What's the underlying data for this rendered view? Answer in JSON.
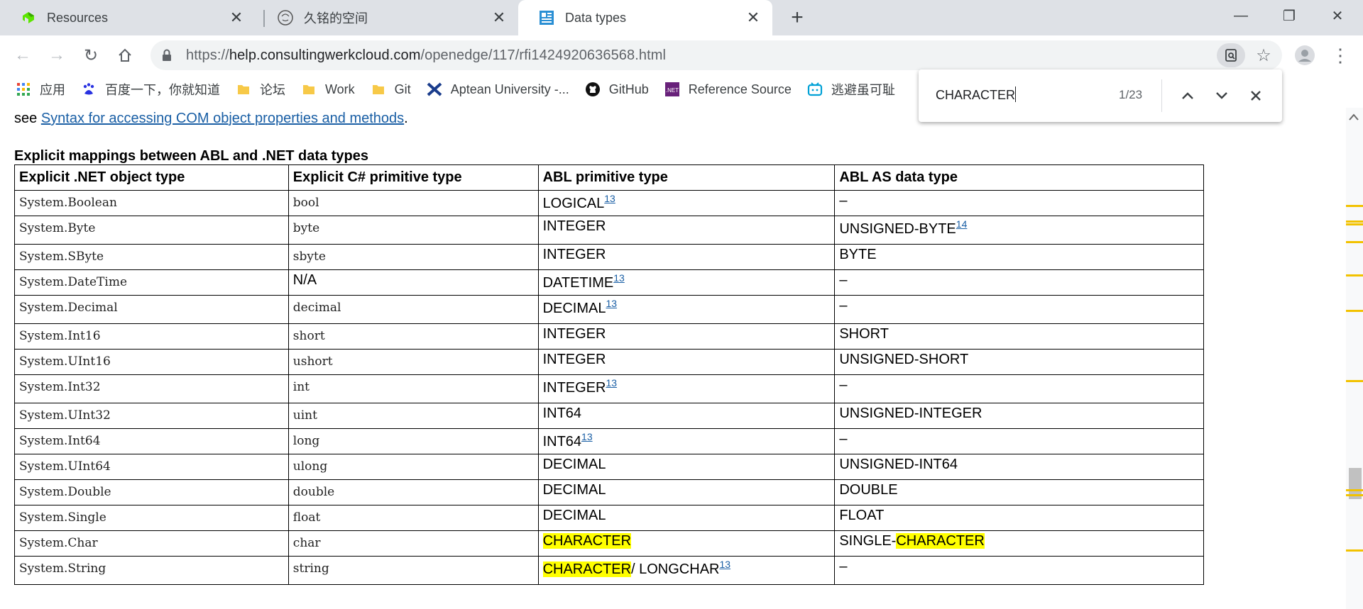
{
  "tabs": [
    {
      "title": "Resources",
      "icon": "progress-logo-icon",
      "active": false
    },
    {
      "title": "久铭的空间",
      "icon": "avatar-sketch-icon",
      "active": false
    },
    {
      "title": "Data types",
      "icon": "document-grid-icon",
      "active": true
    }
  ],
  "omnibox": {
    "url_scheme": "https://",
    "url_host": "help.consultingwerkcloud.com",
    "url_path": "/openedge/117/rfi1424920636568.html"
  },
  "bookmarks": [
    {
      "label": "应用",
      "icon": "apps-grid-icon"
    },
    {
      "label": "百度一下，你就知道",
      "icon": "baidu-paw-icon"
    },
    {
      "label": "论坛",
      "icon": "folder-icon"
    },
    {
      "label": "Work",
      "icon": "folder-icon"
    },
    {
      "label": "Git",
      "icon": "folder-icon"
    },
    {
      "label": "Aptean University -...",
      "icon": "aptean-x-icon"
    },
    {
      "label": "GitHub",
      "icon": "github-icon"
    },
    {
      "label": "Reference Source",
      "icon": "dotnet-icon"
    },
    {
      "label": "逃避虽可耻",
      "icon": "bilibili-icon"
    }
  ],
  "page": {
    "intro_prefix": "see ",
    "intro_link": "Syntax for accessing COM object properties and methods",
    "intro_suffix": ".",
    "table_caption": "Explicit mappings between ABL and .NET data types",
    "headers": [
      "Explicit .NET object type",
      "Explicit C# primitive type",
      "ABL primitive type",
      "ABL AS data type"
    ],
    "rows": [
      {
        "net": "System.Boolean",
        "cs": "bool",
        "abl": "LOGICAL",
        "abl_note": "13",
        "as": "–"
      },
      {
        "net": "System.Byte",
        "cs": "byte",
        "abl": "INTEGER",
        "abl_note": "",
        "as": "UNSIGNED-BYTE",
        "as_note": "14"
      },
      {
        "net": "System.SByte",
        "cs": "sbyte",
        "abl": "INTEGER",
        "abl_note": "",
        "as": "BYTE"
      },
      {
        "net": "System.DateTime",
        "cs": "N/A",
        "abl": "DATETIME",
        "abl_note": "13",
        "as": "–"
      },
      {
        "net": "System.Decimal",
        "cs": "decimal",
        "abl": "DECIMAL",
        "abl_note": "13",
        "as": "–"
      },
      {
        "net": "System.Int16",
        "cs": "short",
        "abl": "INTEGER",
        "abl_note": "",
        "as": "SHORT"
      },
      {
        "net": "System.UInt16",
        "cs": "ushort",
        "abl": "INTEGER",
        "abl_note": "",
        "as": "UNSIGNED-SHORT"
      },
      {
        "net": "System.Int32",
        "cs": "int",
        "abl": "INTEGER",
        "abl_note": "13",
        "as": "–"
      },
      {
        "net": "System.UInt32",
        "cs": "uint",
        "abl": "INT64",
        "abl_note": "",
        "as": "UNSIGNED-INTEGER"
      },
      {
        "net": "System.Int64",
        "cs": "long",
        "abl": "INT64",
        "abl_note": "13",
        "as": "–"
      },
      {
        "net": "System.UInt64",
        "cs": "ulong",
        "abl": "DECIMAL",
        "abl_note": "",
        "as": "UNSIGNED-INT64"
      },
      {
        "net": "System.Double",
        "cs": "double",
        "abl": "DECIMAL",
        "abl_note": "",
        "as": "DOUBLE"
      },
      {
        "net": "System.Single",
        "cs": "float",
        "abl": "DECIMAL",
        "abl_note": "",
        "as": "FLOAT"
      },
      {
        "net": "System.Char",
        "cs": "char",
        "abl_hl": "CHARACTER",
        "abl": "",
        "abl_note": "",
        "as_prefix": "SINGLE-",
        "as_hl": "CHARACTER",
        "as": ""
      },
      {
        "net": "System.String",
        "cs": "string",
        "abl_hl": "CHARACTER",
        "abl": "/ LONGCHAR",
        "abl_note": "13",
        "as": "–"
      }
    ]
  },
  "findbar": {
    "query": "CHARACTER",
    "count": "1/23"
  },
  "colors": {
    "highlight": "#ffff00",
    "link": "#1a5fa5",
    "tabstrip": "#dee1e6",
    "scroll_tick": "#f2c200"
  }
}
